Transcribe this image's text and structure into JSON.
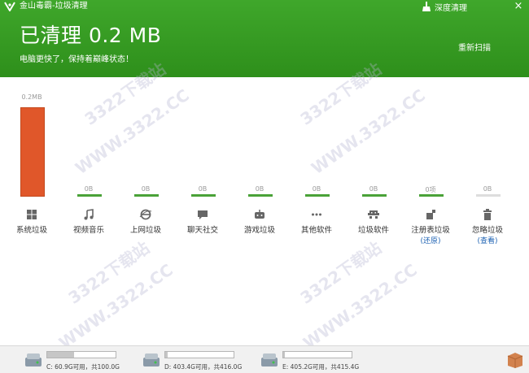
{
  "app": {
    "title": "金山毒霸-垃圾清理",
    "deep_clean_label": "深度清理",
    "close_label": "×"
  },
  "header": {
    "headline": "已清理 0.2 MB",
    "subtitle": "电脑更快了，保持着巅峰状态！",
    "rescan_label": "重新扫描"
  },
  "categories": [
    {
      "label": "系统垃圾",
      "value_label": "0.2MB",
      "fraction": 1,
      "icon": "windows-icon"
    },
    {
      "label": "视频音乐",
      "value_label": "0B",
      "fraction": 0,
      "icon": "music-note-icon"
    },
    {
      "label": "上网垃圾",
      "value_label": "0B",
      "fraction": 0,
      "icon": "browser-e-icon"
    },
    {
      "label": "聊天社交",
      "value_label": "0B",
      "fraction": 0,
      "icon": "chat-bubble-icon"
    },
    {
      "label": "游戏垃圾",
      "value_label": "0B",
      "fraction": 0,
      "icon": "gamepad-icon"
    },
    {
      "label": "其他软件",
      "value_label": "0B",
      "fraction": 0,
      "icon": "dots-icon"
    },
    {
      "label": "垃圾软件",
      "value_label": "0B",
      "fraction": 0,
      "icon": "invader-icon"
    },
    {
      "label": "注册表垃圾",
      "value_label": "0项",
      "fraction": 0,
      "icon": "registry-icon",
      "link": "(还原)"
    },
    {
      "label": "忽略垃圾",
      "value_label": "0B",
      "fraction": 0,
      "icon": "trash-icon",
      "link": "(查看)"
    }
  ],
  "watermarks": [
    "3322下载站",
    "WWW.3322.CC",
    "3322下载站",
    "WWW.3322.CC",
    "3322下载站",
    "WWW.3322.CC",
    "3322下载站",
    "WWW.3322.CC"
  ],
  "drives": [
    {
      "text": "C: 60.9G可用，共100.0G",
      "used_fraction": 0.391
    },
    {
      "text": "D: 403.4G可用，共416.0G",
      "used_fraction": 0.03
    },
    {
      "text": "E: 405.2G可用，共415.4G",
      "used_fraction": 0.025
    }
  ],
  "colors": {
    "header_green": "#3fa72b",
    "bar_orange": "#e0572a",
    "base_green": "#4aa238",
    "link_blue": "#1d62b3"
  }
}
